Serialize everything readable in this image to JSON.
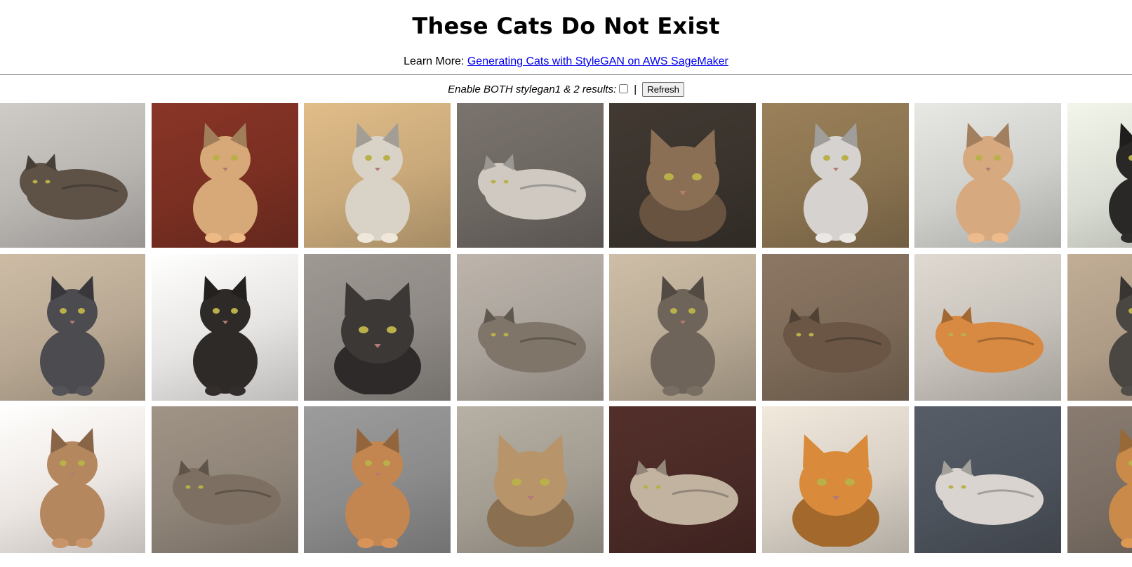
{
  "page": {
    "title": "These Cats Do Not Exist",
    "learn_more_prefix": "Learn More:",
    "learn_more_link": "Generating Cats with StyleGAN on AWS SageMaker",
    "enable_label": "Enable BOTH stylegan1 & 2 results:",
    "separator": "|",
    "refresh_label": "Refresh"
  },
  "grid": {
    "tiles": [
      {
        "bg": "#b9b6b2",
        "fur": "#5e5247",
        "pose": "loaf",
        "row": 0,
        "col": 0
      },
      {
        "bg": "#7a2f22",
        "fur": "#d7a878",
        "pose": "sit",
        "row": 0,
        "col": 1
      },
      {
        "bg": "#c9a97a",
        "fur": "#d9d2c6",
        "pose": "sit",
        "row": 0,
        "col": 2
      },
      {
        "bg": "#6d6762",
        "fur": "#cfc9c2",
        "pose": "loaf",
        "row": 0,
        "col": 3
      },
      {
        "bg": "#3a332d",
        "fur": "#8a6f55",
        "pose": "face",
        "row": 0,
        "col": 4
      },
      {
        "bg": "#8a7350",
        "fur": "#d5d2cf",
        "pose": "sit",
        "row": 0,
        "col": 5
      },
      {
        "bg": "#cfd0cc",
        "fur": "#d7a97f",
        "pose": "sit",
        "row": 0,
        "col": 6
      },
      {
        "bg": "#d9dcd2",
        "fur": "#2a2826",
        "pose": "sit",
        "row": 0,
        "col": 7
      },
      {
        "bg": "#b8a893",
        "fur": "#4b4b50",
        "pose": "sit",
        "row": 1,
        "col": 0
      },
      {
        "bg": "#e6e4e2",
        "fur": "#2e2a28",
        "pose": "sit",
        "row": 1,
        "col": 1
      },
      {
        "bg": "#8e8984",
        "fur": "#3c3836",
        "pose": "face",
        "row": 1,
        "col": 2
      },
      {
        "bg": "#a9a29a",
        "fur": "#7f7568",
        "pose": "loaf",
        "row": 1,
        "col": 3
      },
      {
        "bg": "#b8aa95",
        "fur": "#6e6459",
        "pose": "sit",
        "row": 1,
        "col": 4
      },
      {
        "bg": "#7d6a58",
        "fur": "#6b5646",
        "pose": "loaf",
        "row": 1,
        "col": 5
      },
      {
        "bg": "#c7c2bb",
        "fur": "#d98a42",
        "pose": "loaf",
        "row": 1,
        "col": 6
      },
      {
        "bg": "#ad9b86",
        "fur": "#4a4642",
        "pose": "sit",
        "row": 1,
        "col": 7
      },
      {
        "bg": "#ece6e2",
        "fur": "#b5875f",
        "pose": "sit",
        "row": 2,
        "col": 0
      },
      {
        "bg": "#8f8478",
        "fur": "#7d7062",
        "pose": "loaf",
        "row": 2,
        "col": 1
      },
      {
        "bg": "#8b8b8b",
        "fur": "#c48650",
        "pose": "sit",
        "row": 2,
        "col": 2
      },
      {
        "bg": "#a39d92",
        "fur": "#b8946b",
        "pose": "face",
        "row": 2,
        "col": 3
      },
      {
        "bg": "#4a2a26",
        "fur": "#c2b3a1",
        "pose": "loaf",
        "row": 2,
        "col": 4
      },
      {
        "bg": "#d8d0c5",
        "fur": "#d98a3a",
        "pose": "face",
        "row": 2,
        "col": 5
      },
      {
        "bg": "#4d535c",
        "fur": "#d9d4cf",
        "pose": "loaf",
        "row": 2,
        "col": 6
      },
      {
        "bg": "#7a6e64",
        "fur": "#c98a4a",
        "pose": "sit",
        "row": 2,
        "col": 7
      }
    ]
  }
}
